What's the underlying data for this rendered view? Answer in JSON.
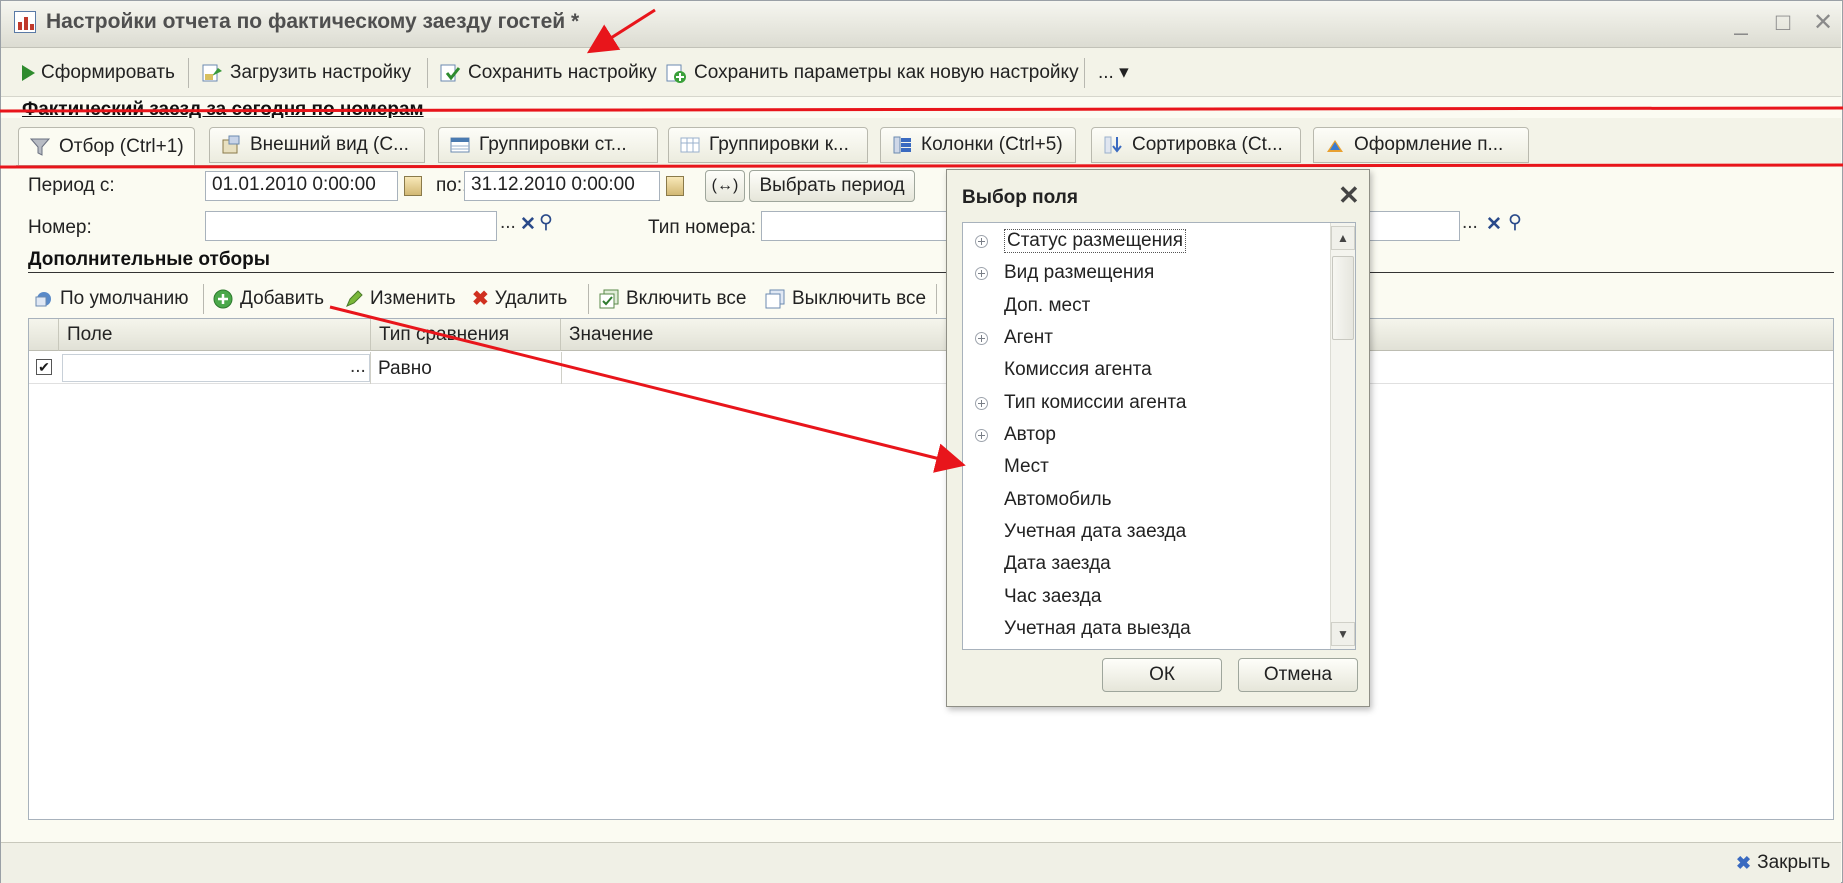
{
  "window": {
    "title": "Настройки отчета по фактическому заезду гостей *",
    "minimize": "_",
    "maximize": "□",
    "close": "✕"
  },
  "toolbar": {
    "generate": "Сформировать",
    "load_settings": "Загрузить настройку",
    "save_settings": "Сохранить настройку",
    "save_as_new": "Сохранить параметры как новую настройку",
    "more": "... ▾"
  },
  "report_name": "Фактический заезд за сегодня по номерам",
  "tabs": [
    {
      "label": "Отбор (Ctrl+1)",
      "icon": "funnel-icon"
    },
    {
      "label": "Внешний вид (С...",
      "icon": "appearance-icon"
    },
    {
      "label": "Группировки ст...",
      "icon": "row-grouping-icon"
    },
    {
      "label": "Группировки к...",
      "icon": "column-grouping-icon"
    },
    {
      "label": "Колонки (Ctrl+5)",
      "icon": "columns-icon"
    },
    {
      "label": "Сортировка (Ct...",
      "icon": "sort-icon"
    },
    {
      "label": "Оформление п...",
      "icon": "design-icon"
    }
  ],
  "filters": {
    "period_from_label": "Период с:",
    "period_from_value": "01.01.2010  0:00:00",
    "period_to_label": "по:",
    "period_to_value": "31.12.2010  0:00:00",
    "period_swap": "(↔)",
    "choose_period": "Выбрать период",
    "room_label": "Номер:",
    "room_value": "",
    "room_type_label": "Тип номера:",
    "room_type_value": "",
    "ellipsis": "...",
    "clear": "✕",
    "search": "⚲"
  },
  "extra_filters": {
    "title": "Дополнительные отборы",
    "toolbar": {
      "default": "По умолчанию",
      "add": "Добавить",
      "edit": "Изменить",
      "delete": "Удалить",
      "enable_all": "Включить все",
      "disable_all": "Выключить все"
    },
    "columns": {
      "field": "Поле",
      "comparison": "Тип сравнения",
      "value": "Значение"
    },
    "rows": [
      {
        "checked": true,
        "field": "",
        "ellipsis": "...",
        "comparison": "Равно",
        "value": ""
      }
    ]
  },
  "field_dialog": {
    "title": "Выбор поля",
    "close": "✕",
    "items": [
      {
        "label": "Статус размещения",
        "expandable": true
      },
      {
        "label": "Вид размещения",
        "expandable": true
      },
      {
        "label": "Доп. мест",
        "expandable": false
      },
      {
        "label": "Агент",
        "expandable": true
      },
      {
        "label": "Комиссия агента",
        "expandable": false
      },
      {
        "label": "Тип комиссии агента",
        "expandable": true
      },
      {
        "label": "Автор",
        "expandable": true
      },
      {
        "label": "Мест",
        "expandable": false
      },
      {
        "label": "Автомобиль",
        "expandable": false
      },
      {
        "label": "Учетная дата заезда",
        "expandable": false
      },
      {
        "label": "Дата заезда",
        "expandable": false
      },
      {
        "label": "Час заезда",
        "expandable": false
      },
      {
        "label": "Учетная дата выезда",
        "expandable": false
      }
    ],
    "ok": "ОК",
    "cancel": "Отмена",
    "scroll_up": "▲",
    "scroll_down": "▼"
  },
  "footer": {
    "close": "Закрыть"
  },
  "annotation_color": "#e8151b"
}
